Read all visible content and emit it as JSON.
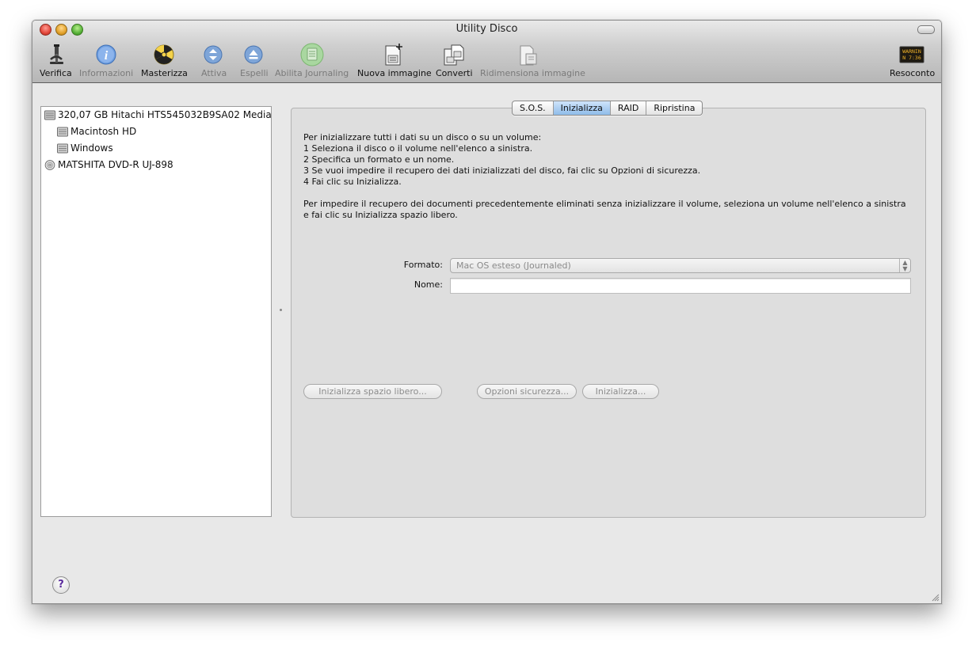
{
  "window": {
    "title": "Utility Disco"
  },
  "toolbar": {
    "items": [
      {
        "label": "Verifica",
        "icon": "microscope-icon",
        "enabled": true
      },
      {
        "label": "Informazioni",
        "icon": "info-icon",
        "enabled": false
      },
      {
        "label": "Masterizza",
        "icon": "burn-icon",
        "enabled": true
      },
      {
        "label": "Attiva",
        "icon": "mount-icon",
        "enabled": false
      },
      {
        "label": "Espelli",
        "icon": "eject-icon",
        "enabled": false
      },
      {
        "label": "Abilita Journaling",
        "icon": "journaling-icon",
        "enabled": false
      },
      {
        "label": "Nuova immagine",
        "icon": "new-image-icon",
        "enabled": true
      },
      {
        "label": "Converti",
        "icon": "convert-icon",
        "enabled": true
      },
      {
        "label": "Ridimensiona immagine",
        "icon": "resize-image-icon",
        "enabled": false
      },
      {
        "label": "Resoconto",
        "icon": "log-icon",
        "enabled": true
      }
    ],
    "log_icon_text": "WARNIN\nN 7:36"
  },
  "sidebar": {
    "items": [
      {
        "label": "320,07 GB Hitachi HTS545032B9SA02 Media",
        "level": 0,
        "icon": "hard-disk-icon"
      },
      {
        "label": "Macintosh HD",
        "level": 1,
        "icon": "volume-icon"
      },
      {
        "label": "Windows",
        "level": 1,
        "icon": "volume-icon"
      },
      {
        "label": "MATSHITA DVD-R UJ-898",
        "level": 0,
        "icon": "optical-drive-icon"
      }
    ]
  },
  "tabs": [
    {
      "label": "S.O.S.",
      "active": false
    },
    {
      "label": "Inizializza",
      "active": true
    },
    {
      "label": "RAID",
      "active": false
    },
    {
      "label": "Ripristina",
      "active": false
    }
  ],
  "erase": {
    "instructions": [
      "Per inizializzare tutti i dati su un disco o su un volume:",
      "1 Seleziona il disco o il volume nell'elenco a sinistra.",
      "2 Specifica un formato e un nome.",
      "3 Se vuoi impedire il recupero dei dati inizializzati del disco, fai clic su Opzioni di sicurezza.",
      "4 Fai clic su Inizializza."
    ],
    "note": "Per impedire il recupero dei documenti precedentemente eliminati senza inizializzare il volume, seleziona un volume nell'elenco a sinistra e fai clic su Inizializza spazio libero.",
    "format_label": "Formato:",
    "format_value": "Mac OS esteso (Journaled)",
    "name_label": "Nome:",
    "name_value": "",
    "buttons": {
      "erase_free_space": "Inizializza spazio libero...",
      "security_options": "Opzioni sicurezza...",
      "erase": "Inizializza..."
    }
  },
  "help": {
    "label": "?"
  },
  "colors": {
    "accent": "#8fbcea",
    "help_glyph": "#5a2a9c"
  }
}
